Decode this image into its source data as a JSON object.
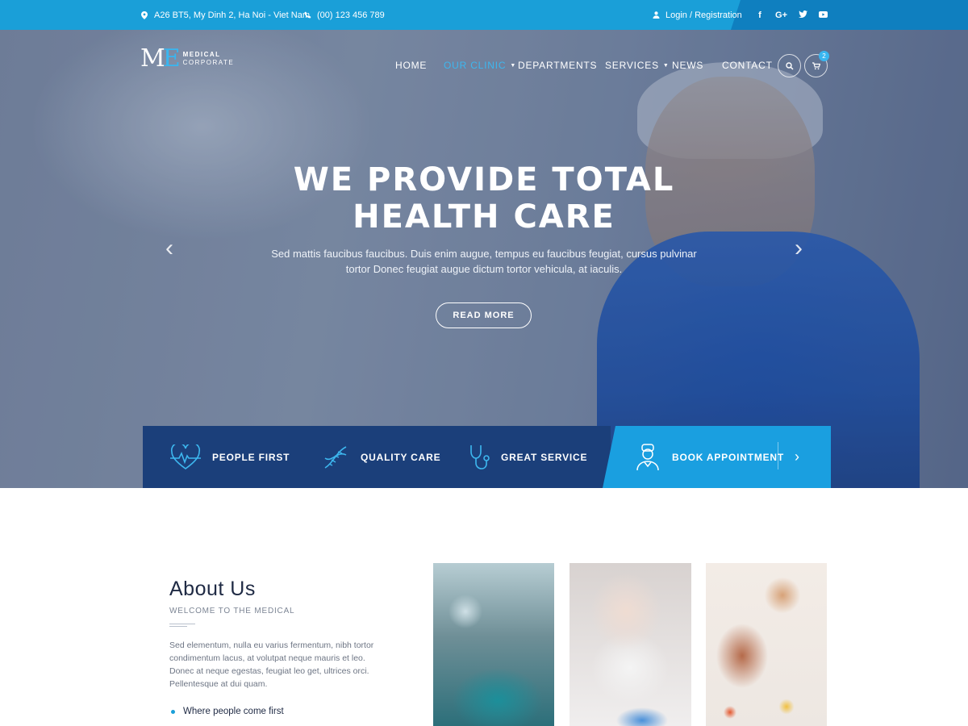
{
  "topbar": {
    "address": "A26 BT5, My Dinh 2, Ha Noi - Viet Nam",
    "phone": "(00) 123 456 789",
    "login": "Login / Registration",
    "social": [
      "f",
      "G+",
      "t",
      "yt"
    ]
  },
  "logo": {
    "mark_m": "M",
    "mark_e": "E",
    "line1": "MEDICAL",
    "line2": "CORPORATE"
  },
  "nav": {
    "items": [
      {
        "label": "HOME"
      },
      {
        "label": "OUR CLINIC"
      },
      {
        "label": "DEPARTMENTS"
      },
      {
        "label": "SERVICES"
      },
      {
        "label": "NEWS"
      },
      {
        "label": "CONTACT"
      }
    ],
    "active": "OUR CLINIC",
    "cart_count": "2"
  },
  "hero": {
    "title_line1": "WE PROVIDE TOTAL",
    "title_line2": "HEALTH CARE",
    "text": "Sed mattis faucibus faucibus. Duis enim augue, tempus eu faucibus feugiat, cursus pulvinar tortor Donec feugiat augue dictum tortor vehicula, at iaculis.",
    "button": "READ MORE"
  },
  "features": [
    {
      "label": "PEOPLE FIRST",
      "icon": "heart-pulse-icon"
    },
    {
      "label": "QUALITY CARE",
      "icon": "dna-icon"
    },
    {
      "label": "GREAT SERVICE",
      "icon": "stethoscope-icon"
    },
    {
      "label": "BOOK APPOINTMENT",
      "icon": "doctor-icon"
    }
  ],
  "about": {
    "title": "About Us",
    "subtitle": "WELCOME TO THE MEDICAL",
    "text": "Sed elementum, nulla eu varius fermentum, nibh tortor condimentum lacus, at volutpat neque mauris et leo. Donec at neque egestas, feugiat leo get, ultrices orci. Pellentesque at dui quam.",
    "list": [
      "Where people come first"
    ]
  },
  "colors": {
    "primary": "#1a9fd8",
    "dark_navy": "#1b3f7a",
    "accent": "#3db7ef"
  }
}
